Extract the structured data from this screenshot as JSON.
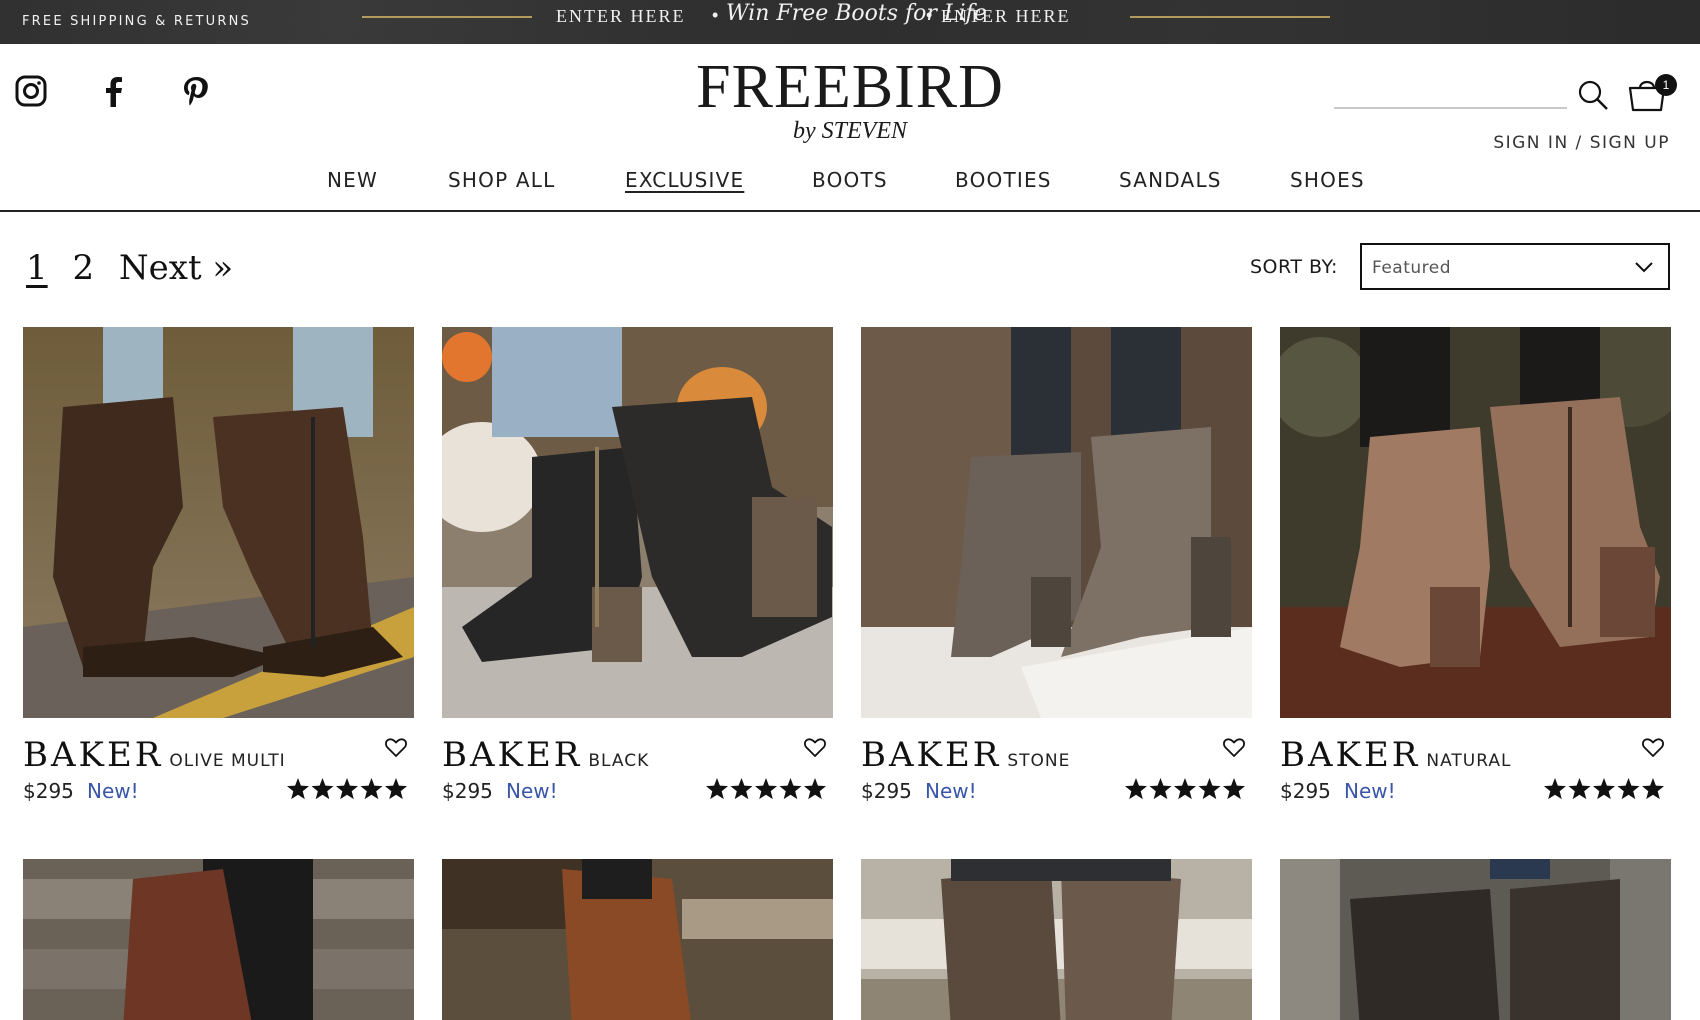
{
  "promo": {
    "shipping": "FREE SHIPPING & RETURNS",
    "enter_left": "ENTER HERE",
    "headline": "Win Free Boots for Life",
    "enter_right": "ENTER HERE",
    "sep": "•"
  },
  "header": {
    "brand": "FREEBIRD",
    "brand_sub": "by STEVEN",
    "cart_count": "1",
    "signin": "SIGN IN / SIGN UP"
  },
  "nav": {
    "items": [
      "NEW",
      "SHOP ALL",
      "EXCLUSIVE",
      "BOOTS",
      "BOOTIES",
      "SANDALS",
      "SHOES"
    ],
    "active": "EXCLUSIVE"
  },
  "pagination": {
    "page1": "1",
    "page2": "2",
    "next": "Next »"
  },
  "sort": {
    "label": "SORT BY:",
    "value": "Featured"
  },
  "products": [
    {
      "model": "BAKER",
      "color": "OLIVE MULTI",
      "price": "$295",
      "badge": "New!",
      "rating": 5
    },
    {
      "model": "BAKER",
      "color": "BLACK",
      "price": "$295",
      "badge": "New!",
      "rating": 5
    },
    {
      "model": "BAKER",
      "color": "STONE",
      "price": "$295",
      "badge": "New!",
      "rating": 5
    },
    {
      "model": "BAKER",
      "color": "NATURAL",
      "price": "$295",
      "badge": "New!",
      "rating": 5
    }
  ],
  "colors": {
    "promo_bg": "#2b2b2b",
    "gold": "#b39b5e",
    "new_badge": "#3a56a8",
    "text": "#1a1a1a"
  }
}
